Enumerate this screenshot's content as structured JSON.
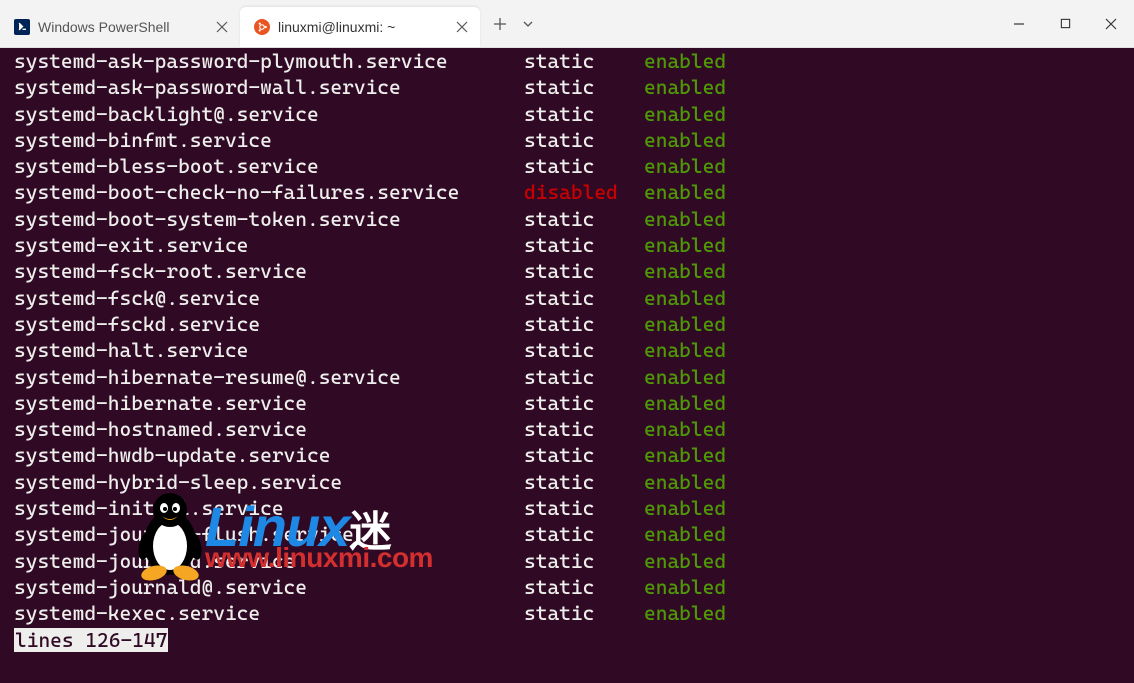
{
  "tabs": [
    {
      "title": "Windows PowerShell",
      "icon": "powershell",
      "active": false
    },
    {
      "title": "linuxmi@linuxmi: ~",
      "icon": "ubuntu",
      "active": true
    }
  ],
  "terminal": {
    "rows": [
      {
        "unit": "systemd-ask-password-plymouth.service",
        "state": "static",
        "state_color": "white",
        "vendor": "enabled",
        "vendor_color": "green"
      },
      {
        "unit": "systemd-ask-password-wall.service",
        "state": "static",
        "state_color": "white",
        "vendor": "enabled",
        "vendor_color": "green"
      },
      {
        "unit": "systemd-backlight@.service",
        "state": "static",
        "state_color": "white",
        "vendor": "enabled",
        "vendor_color": "green"
      },
      {
        "unit": "systemd-binfmt.service",
        "state": "static",
        "state_color": "white",
        "vendor": "enabled",
        "vendor_color": "green"
      },
      {
        "unit": "systemd-bless-boot.service",
        "state": "static",
        "state_color": "white",
        "vendor": "enabled",
        "vendor_color": "green"
      },
      {
        "unit": "systemd-boot-check-no-failures.service",
        "state": "disabled",
        "state_color": "red",
        "vendor": "enabled",
        "vendor_color": "green"
      },
      {
        "unit": "systemd-boot-system-token.service",
        "state": "static",
        "state_color": "white",
        "vendor": "enabled",
        "vendor_color": "green"
      },
      {
        "unit": "systemd-exit.service",
        "state": "static",
        "state_color": "white",
        "vendor": "enabled",
        "vendor_color": "green"
      },
      {
        "unit": "systemd-fsck-root.service",
        "state": "static",
        "state_color": "white",
        "vendor": "enabled",
        "vendor_color": "green"
      },
      {
        "unit": "systemd-fsck@.service",
        "state": "static",
        "state_color": "white",
        "vendor": "enabled",
        "vendor_color": "green"
      },
      {
        "unit": "systemd-fsckd.service",
        "state": "static",
        "state_color": "white",
        "vendor": "enabled",
        "vendor_color": "green"
      },
      {
        "unit": "systemd-halt.service",
        "state": "static",
        "state_color": "white",
        "vendor": "enabled",
        "vendor_color": "green"
      },
      {
        "unit": "systemd-hibernate-resume@.service",
        "state": "static",
        "state_color": "white",
        "vendor": "enabled",
        "vendor_color": "green"
      },
      {
        "unit": "systemd-hibernate.service",
        "state": "static",
        "state_color": "white",
        "vendor": "enabled",
        "vendor_color": "green"
      },
      {
        "unit": "systemd-hostnamed.service",
        "state": "static",
        "state_color": "white",
        "vendor": "enabled",
        "vendor_color": "green"
      },
      {
        "unit": "systemd-hwdb-update.service",
        "state": "static",
        "state_color": "white",
        "vendor": "enabled",
        "vendor_color": "green"
      },
      {
        "unit": "systemd-hybrid-sleep.service",
        "state": "static",
        "state_color": "white",
        "vendor": "enabled",
        "vendor_color": "green"
      },
      {
        "unit": "systemd-initctl.service",
        "state": "static",
        "state_color": "white",
        "vendor": "enabled",
        "vendor_color": "green"
      },
      {
        "unit": "systemd-journal-flush.service",
        "state": "static",
        "state_color": "white",
        "vendor": "enabled",
        "vendor_color": "green"
      },
      {
        "unit": "systemd-journald.service",
        "state": "static",
        "state_color": "white",
        "vendor": "enabled",
        "vendor_color": "green"
      },
      {
        "unit": "systemd-journald@.service",
        "state": "static",
        "state_color": "white",
        "vendor": "enabled",
        "vendor_color": "green"
      },
      {
        "unit": "systemd-kexec.service",
        "state": "static",
        "state_color": "white",
        "vendor": "enabled",
        "vendor_color": "green"
      }
    ],
    "pager": "lines 126-147"
  },
  "watermark": {
    "text1": "Linux",
    "text2": "迷",
    "url": "www.linuxmi.com"
  }
}
